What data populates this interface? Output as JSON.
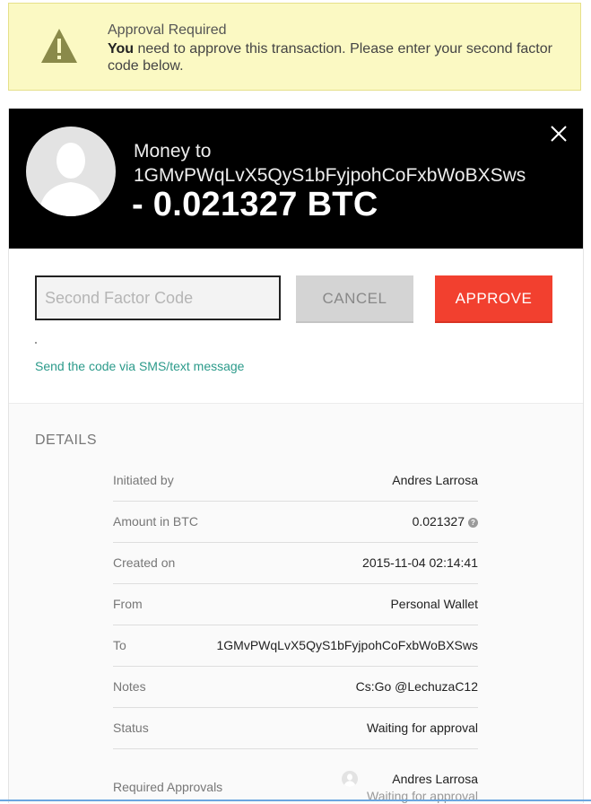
{
  "alert": {
    "title": "Approval Required",
    "body_strong": "You",
    "body_rest": " need to approve this transaction. Please enter your second factor code below.",
    "icon": "warning-triangle-icon"
  },
  "header": {
    "label": "Money to",
    "address": "1GMvPWqLvX5QyS1bFyjpohCoFxbWoBXSws",
    "amount": "- 0.021327 BTC"
  },
  "form": {
    "code_placeholder": "Second Factor Code",
    "cancel_label": "CANCEL",
    "approve_label": "APPROVE",
    "sms_link": "Send the code via SMS/text message"
  },
  "details": {
    "title": "DETAILS",
    "rows": [
      {
        "label": "Initiated by",
        "value": "Andres Larrosa"
      },
      {
        "label": "Amount in BTC",
        "value": "0.021327"
      },
      {
        "label": "Created on",
        "value": "2015-11-04 02:14:41"
      },
      {
        "label": "From",
        "value": "Personal Wallet"
      },
      {
        "label": "To",
        "value": "1GMvPWqLvX5QyS1bFyjpohCoFxbWoBXSws"
      },
      {
        "label": "Notes",
        "value": "Cs:Go @LechuzaC12"
      },
      {
        "label": "Status",
        "value": "Waiting for approval"
      }
    ],
    "required_approvals": {
      "label": "Required Approvals",
      "user": "Andres Larrosa",
      "state": "Waiting for approval"
    }
  },
  "colors": {
    "alert_bg": "#fbf9c3",
    "approve": "#f2402f",
    "link": "#2b9a8a",
    "header_bg": "#000000"
  }
}
